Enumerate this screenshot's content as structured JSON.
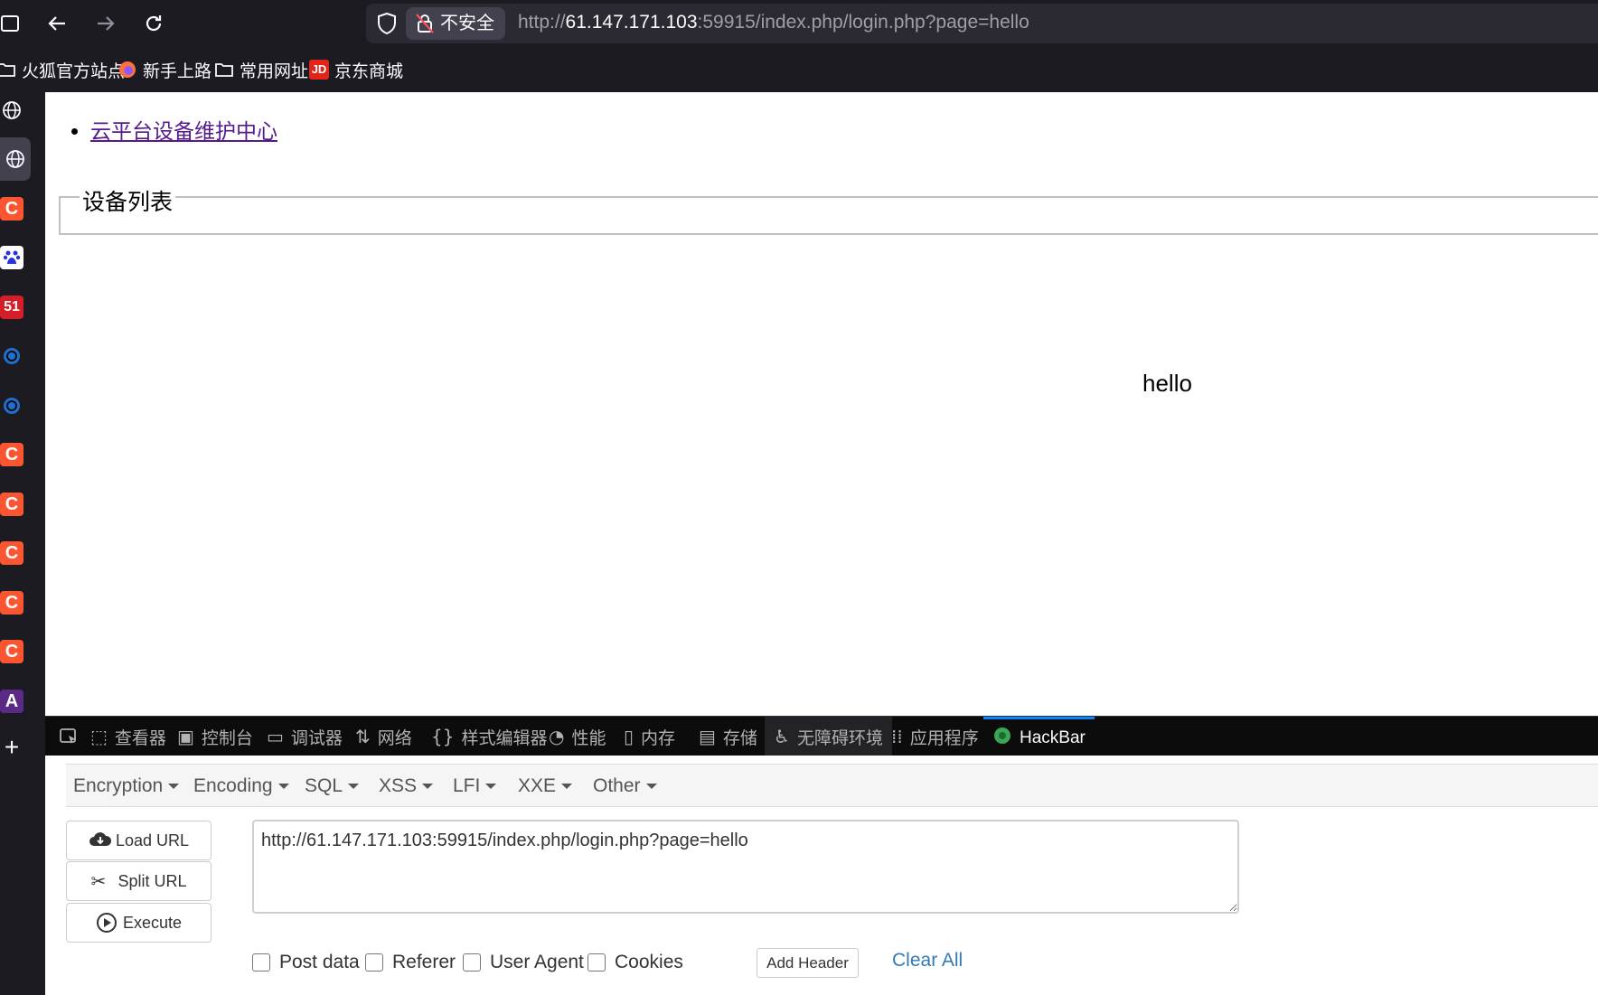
{
  "toolbar": {
    "security_label": "不安全",
    "url_prefix": "http://",
    "url_host": "61.147.171.103",
    "url_rest": ":59915/index.php/login.php?page=hello"
  },
  "bookmarks": [
    {
      "label": "火狐官方站点",
      "icon": "folder-icon"
    },
    {
      "label": "新手上路",
      "icon": "firefox-icon"
    },
    {
      "label": "常用网址",
      "icon": "folder-icon"
    },
    {
      "label": "京东商城",
      "icon": "jd-icon"
    }
  ],
  "sidebar": {
    "items": [
      "globe",
      "globe",
      "C",
      "baidu",
      "51",
      "spiral",
      "spiral",
      "C",
      "C",
      "C",
      "C",
      "C",
      "A",
      "+"
    ]
  },
  "page": {
    "nav_link": "云平台设备维护中心",
    "legend": "设备列表",
    "output": "hello"
  },
  "devtools": {
    "tabs": [
      {
        "label": "查看器",
        "icon": "inspector-icon"
      },
      {
        "label": "控制台",
        "icon": "console-icon"
      },
      {
        "label": "调试器",
        "icon": "debugger-icon"
      },
      {
        "label": "网络",
        "icon": "network-icon"
      },
      {
        "label": "样式编辑器",
        "icon": "style-editor-icon"
      },
      {
        "label": "性能",
        "icon": "performance-icon"
      },
      {
        "label": "内存",
        "icon": "memory-icon"
      },
      {
        "label": "存储",
        "icon": "storage-icon"
      },
      {
        "label": "无障碍环境",
        "icon": "accessibility-icon"
      },
      {
        "label": "应用程序",
        "icon": "application-icon"
      },
      {
        "label": "HackBar",
        "icon": "hackbar-icon"
      }
    ]
  },
  "hackbar": {
    "menus": [
      "Encryption",
      "Encoding",
      "SQL",
      "XSS",
      "LFI",
      "XXE",
      "Other"
    ],
    "buttons": {
      "load": "Load URL",
      "split": "Split URL",
      "execute": "Execute"
    },
    "url_value": "http://61.147.171.103:59915/index.php/login.php?page=hello",
    "options": [
      "Post data",
      "Referer",
      "User Agent",
      "Cookies"
    ],
    "add_header": "Add Header",
    "clear_all": "Clear All"
  }
}
